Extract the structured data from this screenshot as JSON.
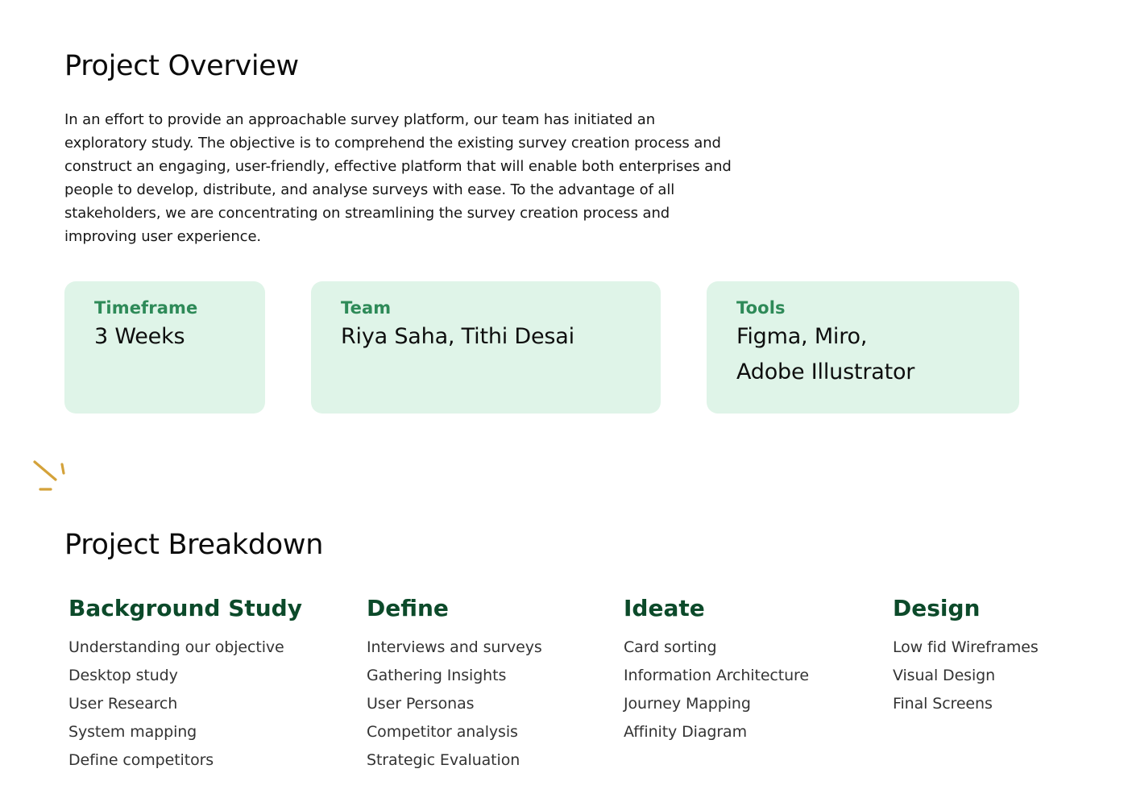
{
  "overview": {
    "title": "Project Overview",
    "description": "In an effort to provide an approachable survey platform, our team has initiated an exploratory study. The objective is to comprehend the existing survey creation process and construct an engaging, user-friendly, effective platform that will enable both enterprises and people to develop, distribute, and analyse surveys with ease. To the advantage of all stakeholders, we are concentrating on streamlining the survey creation process and improving user experience."
  },
  "cards": [
    {
      "label": "Timeframe",
      "value": "3 Weeks"
    },
    {
      "label": "Team",
      "value": "Riya Saha, Tithi Desai"
    },
    {
      "label": "Tools",
      "value_line1": "Figma, Miro,",
      "value_line2": "Adobe Illustrator"
    }
  ],
  "decoration": {
    "icon": "sparkle-icon",
    "color": "#d4a23a"
  },
  "colors": {
    "card_background": "#dff4e8",
    "card_label": "#2e8a58",
    "phase_heading": "#0c4a2a"
  },
  "breakdown": {
    "title": "Project Breakdown",
    "phases": [
      {
        "title": "Background Study",
        "items": [
          "Understanding our objective",
          "Desktop study",
          "User Research",
          "System mapping",
          "Define competitors"
        ]
      },
      {
        "title": "Define",
        "items": [
          "Interviews and surveys",
          "Gathering Insights",
          "User Personas",
          "Competitor analysis",
          "Strategic Evaluation"
        ]
      },
      {
        "title": "Ideate",
        "items": [
          "Card sorting",
          "Information Architecture",
          "Journey Mapping",
          "Affinity Diagram"
        ]
      },
      {
        "title": "Design",
        "items": [
          "Low fid Wireframes",
          "Visual Design",
          "Final Screens"
        ]
      }
    ]
  }
}
